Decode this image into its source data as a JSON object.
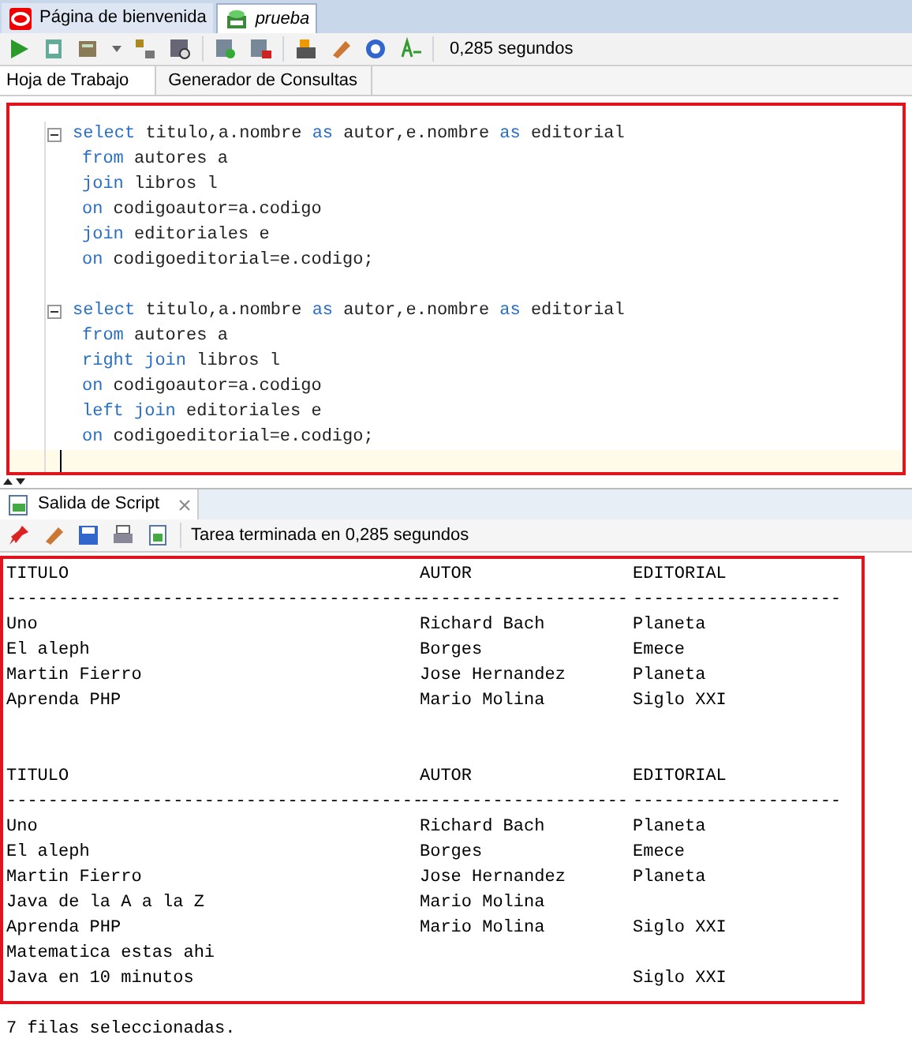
{
  "doc_tabs": [
    {
      "label": "Página de bienvenida",
      "selected": false
    },
    {
      "label": "prueba",
      "selected": true
    }
  ],
  "toolbar": {
    "status": "0,285 segundos"
  },
  "sub_tabs": [
    {
      "label": "Hoja de Trabajo",
      "selected": true
    },
    {
      "label": "Generador de Consultas",
      "selected": false
    }
  ],
  "editor": {
    "statements": [
      [
        [
          {
            "text": "select",
            "kind": "keyword"
          },
          {
            "text": " titulo,a.nombre ",
            "kind": "plain"
          },
          {
            "text": "as",
            "kind": "keyword"
          },
          {
            "text": " autor,e.nombre ",
            "kind": "plain"
          },
          {
            "text": "as",
            "kind": "keyword"
          },
          {
            "text": " editorial",
            "kind": "plain"
          }
        ],
        [
          {
            "text": "from",
            "kind": "keyword"
          },
          {
            "text": " autores a",
            "kind": "plain"
          }
        ],
        [
          {
            "text": "join",
            "kind": "keyword"
          },
          {
            "text": " libros l",
            "kind": "plain"
          }
        ],
        [
          {
            "text": "on",
            "kind": "keyword"
          },
          {
            "text": " codigoautor=a.codigo",
            "kind": "plain"
          }
        ],
        [
          {
            "text": "join",
            "kind": "keyword"
          },
          {
            "text": " editoriales e",
            "kind": "plain"
          }
        ],
        [
          {
            "text": "on",
            "kind": "keyword"
          },
          {
            "text": " codigoeditorial=e.codigo;",
            "kind": "plain"
          }
        ]
      ],
      [
        [
          {
            "text": "select",
            "kind": "keyword"
          },
          {
            "text": " titulo,a.nombre ",
            "kind": "plain"
          },
          {
            "text": "as",
            "kind": "keyword"
          },
          {
            "text": " autor,e.nombre ",
            "kind": "plain"
          },
          {
            "text": "as",
            "kind": "keyword"
          },
          {
            "text": " editorial",
            "kind": "plain"
          }
        ],
        [
          {
            "text": "from",
            "kind": "keyword"
          },
          {
            "text": " autores a",
            "kind": "plain"
          }
        ],
        [
          {
            "text": "right join",
            "kind": "keyword"
          },
          {
            "text": " libros l",
            "kind": "plain"
          }
        ],
        [
          {
            "text": "on",
            "kind": "keyword"
          },
          {
            "text": " codigoautor=a.codigo",
            "kind": "plain"
          }
        ],
        [
          {
            "text": "left join",
            "kind": "keyword"
          },
          {
            "text": " editoriales e",
            "kind": "plain"
          }
        ],
        [
          {
            "text": "on",
            "kind": "keyword"
          },
          {
            "text": " codigoeditorial=e.codigo;",
            "kind": "plain"
          }
        ]
      ]
    ]
  },
  "output_panel": {
    "tab": "Salida de Script",
    "status": "Tarea terminada en 0,285 segundos"
  },
  "output": {
    "blocks": [
      {
        "columns": [
          "TITULO",
          "AUTOR",
          "EDITORIAL"
        ],
        "dashes": [
          "----------------------------------------",
          "--------------------",
          "--------------------"
        ],
        "rows": [
          [
            "Uno",
            "Richard Bach",
            "Planeta"
          ],
          [
            "El aleph",
            "Borges",
            "Emece"
          ],
          [
            "Martin Fierro",
            "Jose Hernandez",
            "Planeta"
          ],
          [
            "Aprenda PHP",
            "Mario Molina",
            "Siglo XXI"
          ]
        ]
      },
      {
        "columns": [
          "TITULO",
          "AUTOR",
          "EDITORIAL"
        ],
        "dashes": [
          "----------------------------------------",
          "--------------------",
          "--------------------"
        ],
        "rows": [
          [
            "Uno",
            "Richard Bach",
            "Planeta"
          ],
          [
            "El aleph",
            "Borges",
            "Emece"
          ],
          [
            "Martin Fierro",
            "Jose Hernandez",
            "Planeta"
          ],
          [
            "Java de la A a la Z",
            "Mario Molina",
            ""
          ],
          [
            "Aprenda PHP",
            "Mario Molina",
            "Siglo XXI"
          ],
          [
            "Matematica estas ahi",
            "",
            ""
          ],
          [
            "Java en 10 minutos",
            "",
            "Siglo XXI"
          ]
        ]
      }
    ],
    "footer": "7 filas seleccionadas."
  }
}
